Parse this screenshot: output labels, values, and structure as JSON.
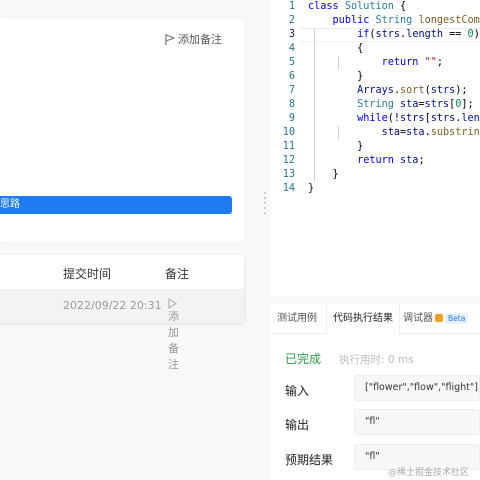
{
  "left_panel": {
    "add_note_top": "添加备注",
    "blue_bar_text": "思路",
    "table": {
      "headers": [
        "",
        "提交时间",
        "备注"
      ],
      "row": {
        "time": "2022/09/22 20:31",
        "note": "添加备注"
      }
    }
  },
  "editor": {
    "lines": [
      {
        "n": "1"
      },
      {
        "n": "2"
      },
      {
        "n": "3"
      },
      {
        "n": "4"
      },
      {
        "n": "5"
      },
      {
        "n": "6"
      },
      {
        "n": "7"
      },
      {
        "n": "8"
      },
      {
        "n": "9"
      },
      {
        "n": "10"
      },
      {
        "n": "11"
      },
      {
        "n": "12"
      },
      {
        "n": "13"
      },
      {
        "n": "14"
      }
    ]
  },
  "console": {
    "tabs": [
      "测试用例",
      "代码执行结果",
      "调试器"
    ],
    "beta": "Beta",
    "status": "已完成",
    "exec_time": "执行用时: 0 ms",
    "input_label": "输入",
    "input_value": "[\"flower\",\"flow\",\"flight\"]",
    "output_label": "输出",
    "output_value": "\"fl\"",
    "expected_label": "预期结果",
    "expected_value": "\"fl\""
  },
  "watermark": "@稀土掘金技术社区",
  "colors": {
    "accent": "#1e7bf2",
    "success": "#2e9a48",
    "line_number": "#237893"
  }
}
